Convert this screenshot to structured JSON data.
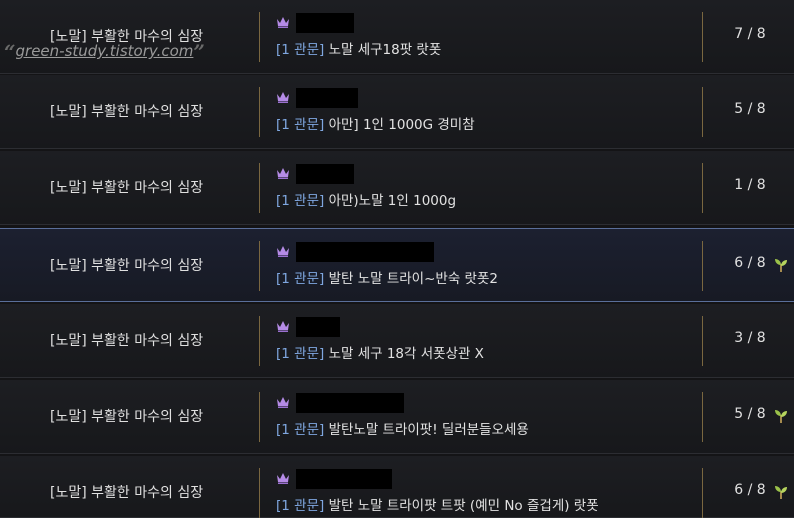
{
  "watermark": "green-study.tistory.com",
  "rows": [
    {
      "raid": "[노말] 부활한 마수의 심장",
      "tag": "[1 관문]",
      "title": "노말 세구18팟 랏폿",
      "count": "7 / 8",
      "sprout": false,
      "selected": false
    },
    {
      "raid": "[노말] 부활한 마수의 심장",
      "tag": "[1 관문]",
      "title": "아만] 1인 1000G 경미참",
      "count": "5 / 8",
      "sprout": false,
      "selected": false
    },
    {
      "raid": "[노말] 부활한 마수의 심장",
      "tag": "[1 관문]",
      "title": "아만)노말 1인 1000g",
      "count": "1 / 8",
      "sprout": false,
      "selected": false
    },
    {
      "raid": "[노말] 부활한 마수의 심장",
      "tag": "[1 관문]",
      "title": "발탄 노말 트라이~반숙 랏폿2",
      "count": "6 / 8",
      "sprout": true,
      "selected": true
    },
    {
      "raid": "[노말] 부활한 마수의 심장",
      "tag": "[1 관문]",
      "title": "노말 세구 18각 서폿상관 X",
      "count": "3 / 8",
      "sprout": false,
      "selected": false
    },
    {
      "raid": "[노말] 부활한 마수의 심장",
      "tag": "[1 관문]",
      "title": "발탄노말 트라이팟! 딜러분들오세용",
      "count": "5 / 8",
      "sprout": true,
      "selected": false
    },
    {
      "raid": "[노말] 부활한 마수의 심장",
      "tag": "[1 관문]",
      "title": "발탄 노말 트라이팟 트팟 (예민 No 즐겁게) 랏폿",
      "count": "6 / 8",
      "sprout": true,
      "selected": false
    }
  ]
}
